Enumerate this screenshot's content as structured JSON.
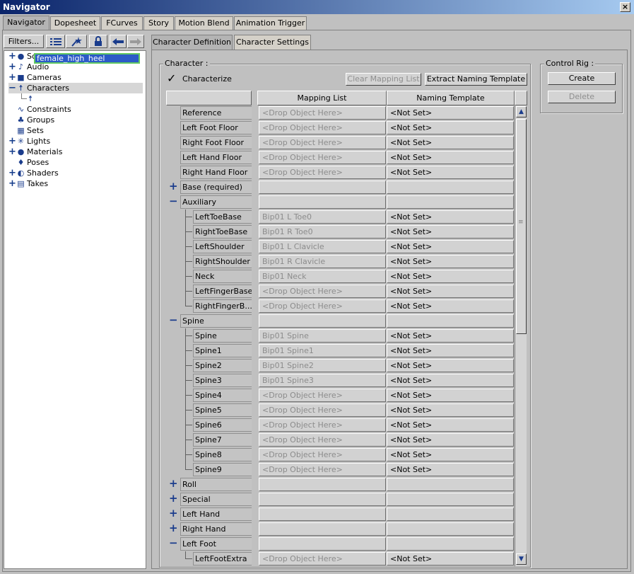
{
  "window": {
    "title": "Navigator",
    "close_glyph": "×"
  },
  "tabs": [
    "Navigator",
    "Dopesheet",
    "FCurves",
    "Story",
    "Motion Blend",
    "Animation Trigger"
  ],
  "toolbar": {
    "filters": "Filters...",
    "icons": [
      "list-icon",
      "star-icon",
      "lock-icon",
      "arrow-left-icon",
      "arrow-right-icon"
    ]
  },
  "tree": [
    {
      "label": "Scene",
      "pm": "+",
      "icon": "scene-icon"
    },
    {
      "label": "Audio",
      "pm": "+",
      "icon": "audio-icon"
    },
    {
      "label": "Cameras",
      "pm": "+",
      "icon": "camera-icon"
    },
    {
      "label": "Characters",
      "pm": "−",
      "icon": "character-icon"
    },
    {
      "label": "female_high_heel",
      "selected": true,
      "icon": "character-icon"
    },
    {
      "label": "Constraints",
      "pm": "",
      "icon": "constraint-icon"
    },
    {
      "label": "Groups",
      "pm": "",
      "icon": "group-icon"
    },
    {
      "label": "Sets",
      "pm": "",
      "icon": "set-icon"
    },
    {
      "label": "Lights",
      "pm": "+",
      "icon": "light-icon"
    },
    {
      "label": "Materials",
      "pm": "+",
      "icon": "material-icon"
    },
    {
      "label": "Poses",
      "pm": "",
      "icon": "pose-icon"
    },
    {
      "label": "Shaders",
      "pm": "+",
      "icon": "shader-icon"
    },
    {
      "label": "Takes",
      "pm": "+",
      "icon": "take-icon"
    }
  ],
  "subtabs": [
    "Character Definition",
    "Character Settings"
  ],
  "character": {
    "group_label": "Character :",
    "characterize_label": "Characterize",
    "characterize_checked": true,
    "clear_mapping": "Clear Mapping List",
    "extract_naming": "Extract Naming Template"
  },
  "control_rig": {
    "group_label": "Control Rig :",
    "create": "Create",
    "delete": "Delete"
  },
  "grid": {
    "headers": [
      "Mapping List",
      "Naming Template"
    ],
    "rows": [
      {
        "label": "Reference",
        "indent": 0,
        "map": "<Drop Object Here>",
        "naming": "<Not Set>"
      },
      {
        "label": "Left Foot Floor",
        "indent": 0,
        "map": "<Drop Object Here>",
        "naming": "<Not Set>"
      },
      {
        "label": "Right Foot Floor",
        "indent": 0,
        "map": "<Drop Object Here>",
        "naming": "<Not Set>"
      },
      {
        "label": "Left Hand Floor",
        "indent": 0,
        "map": "<Drop Object Here>",
        "naming": "<Not Set>"
      },
      {
        "label": "Right Hand Floor",
        "indent": 0,
        "map": "<Drop Object Here>",
        "naming": "<Not Set>"
      },
      {
        "label": "Base (required)",
        "indent": 0,
        "pm": "+",
        "map": "",
        "naming": ""
      },
      {
        "label": "Auxiliary",
        "indent": 0,
        "pm": "−",
        "map": "",
        "naming": ""
      },
      {
        "label": "LeftToeBase",
        "indent": 1,
        "map": "Bip01 L Toe0",
        "naming": "<Not Set>"
      },
      {
        "label": "RightToeBase",
        "indent": 1,
        "map": "Bip01 R Toe0",
        "naming": "<Not Set>"
      },
      {
        "label": "LeftShoulder",
        "indent": 1,
        "map": "Bip01 L Clavicle",
        "naming": "<Not Set>"
      },
      {
        "label": "RightShoulder",
        "indent": 1,
        "map": "Bip01 R Clavicle",
        "naming": "<Not Set>"
      },
      {
        "label": "Neck",
        "indent": 1,
        "map": "Bip01 Neck",
        "naming": "<Not Set>"
      },
      {
        "label": "LeftFingerBase",
        "indent": 1,
        "map": "<Drop Object Here>",
        "naming": "<Not Set>"
      },
      {
        "label": "RightFingerB...",
        "indent": 1,
        "map": "<Drop Object Here>",
        "naming": "<Not Set>"
      },
      {
        "label": "Spine",
        "indent": 0,
        "pm": "−",
        "map": "",
        "naming": ""
      },
      {
        "label": "Spine",
        "indent": 1,
        "map": "Bip01 Spine",
        "naming": "<Not Set>"
      },
      {
        "label": "Spine1",
        "indent": 1,
        "map": "Bip01 Spine1",
        "naming": "<Not Set>"
      },
      {
        "label": "Spine2",
        "indent": 1,
        "map": "Bip01 Spine2",
        "naming": "<Not Set>"
      },
      {
        "label": "Spine3",
        "indent": 1,
        "map": "Bip01 Spine3",
        "naming": "<Not Set>"
      },
      {
        "label": "Spine4",
        "indent": 1,
        "map": "<Drop Object Here>",
        "naming": "<Not Set>"
      },
      {
        "label": "Spine5",
        "indent": 1,
        "map": "<Drop Object Here>",
        "naming": "<Not Set>"
      },
      {
        "label": "Spine6",
        "indent": 1,
        "map": "<Drop Object Here>",
        "naming": "<Not Set>"
      },
      {
        "label": "Spine7",
        "indent": 1,
        "map": "<Drop Object Here>",
        "naming": "<Not Set>"
      },
      {
        "label": "Spine8",
        "indent": 1,
        "map": "<Drop Object Here>",
        "naming": "<Not Set>"
      },
      {
        "label": "Spine9",
        "indent": 1,
        "map": "<Drop Object Here>",
        "naming": "<Not Set>"
      },
      {
        "label": "Roll",
        "indent": 0,
        "pm": "+",
        "map": "",
        "naming": ""
      },
      {
        "label": "Special",
        "indent": 0,
        "pm": "+",
        "map": "",
        "naming": ""
      },
      {
        "label": "Left Hand",
        "indent": 0,
        "pm": "+",
        "map": "",
        "naming": ""
      },
      {
        "label": "Right Hand",
        "indent": 0,
        "pm": "+",
        "map": "",
        "naming": ""
      },
      {
        "label": "Left Foot",
        "indent": 0,
        "pm": "−",
        "map": "",
        "naming": ""
      },
      {
        "label": "LeftFootExtra",
        "indent": 1,
        "map": "<Drop Object Here>",
        "naming": "<Not Set>"
      }
    ]
  },
  "scrollbar": {
    "up_glyph": "▲",
    "down_glyph": "▼",
    "grip_glyph": "≡"
  }
}
